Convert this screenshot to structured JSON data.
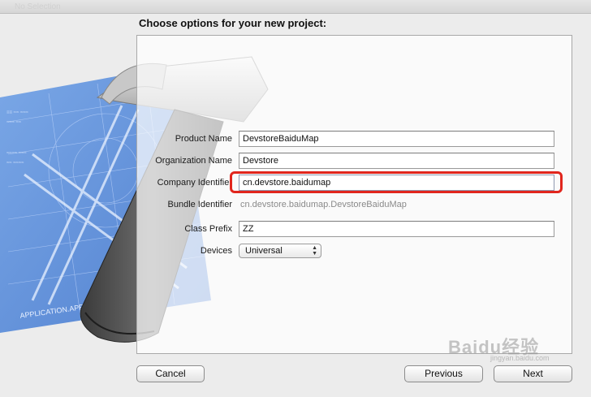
{
  "window": {
    "ghost_title": "No Selection"
  },
  "heading": "Choose options for your new project:",
  "form": {
    "product_name": {
      "label": "Product Name",
      "value": "DevstoreBaiduMap"
    },
    "organization_name": {
      "label": "Organization Name",
      "value": "Devstore"
    },
    "company_identifier": {
      "label": "Company Identifier",
      "value": "cn.devstore.baidumap"
    },
    "bundle_identifier": {
      "label": "Bundle Identifier",
      "value": "cn.devstore.baidumap.DevstoreBaiduMap"
    },
    "class_prefix": {
      "label": "Class Prefix",
      "value": "ZZ"
    },
    "devices": {
      "label": "Devices",
      "value": "Universal"
    }
  },
  "artwork": {
    "blueprint_caption": "APPLICATION.APP"
  },
  "buttons": {
    "cancel": "Cancel",
    "previous": "Previous",
    "next": "Next"
  },
  "watermark": {
    "logo": "Baidu经验",
    "url": "jingyan.baidu.com"
  },
  "colors": {
    "highlight": "#e1261d",
    "blueprint": "#4f86d9",
    "panel_border": "#a9a9a9"
  }
}
